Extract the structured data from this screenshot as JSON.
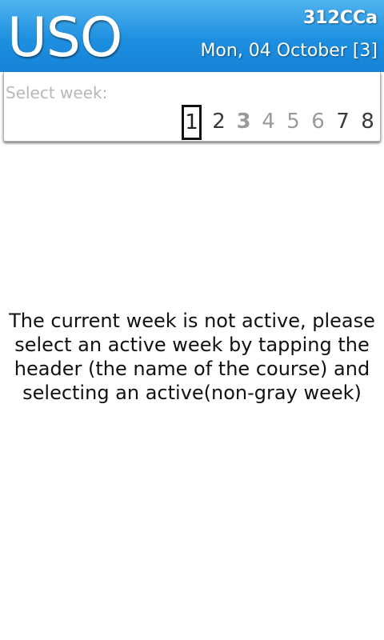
{
  "header": {
    "course_name": "USO",
    "course_code": "312CCa",
    "date": "Mon, 04 October [3]"
  },
  "week_selector": {
    "label": "Select week:",
    "selected_week": "1",
    "current_week": "3",
    "weeks": [
      {
        "number": "1",
        "state": "active"
      },
      {
        "number": "2",
        "state": "active"
      },
      {
        "number": "3",
        "state": "inactive"
      },
      {
        "number": "4",
        "state": "inactive"
      },
      {
        "number": "5",
        "state": "inactive"
      },
      {
        "number": "6",
        "state": "inactive"
      },
      {
        "number": "7",
        "state": "active"
      },
      {
        "number": "8",
        "state": "active"
      }
    ]
  },
  "message": "The current week is not active, please select an active week by tapping the header (the name of the course) and selecting an active(non-gray week)"
}
